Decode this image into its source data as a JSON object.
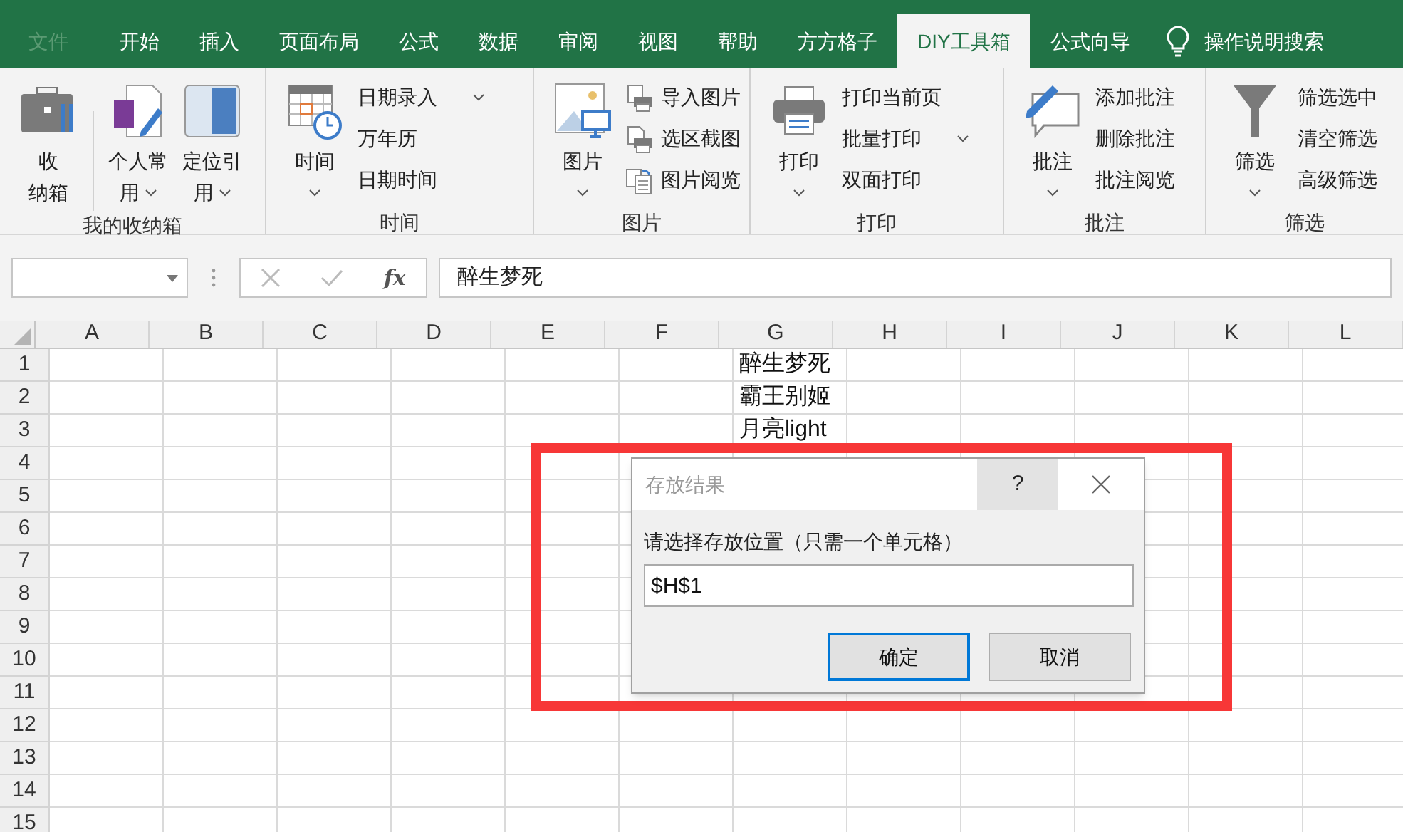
{
  "tabs": [
    {
      "label": "文件",
      "kind": "file",
      "selected": false
    },
    {
      "label": "开始",
      "kind": "tab",
      "selected": false
    },
    {
      "label": "插入",
      "kind": "tab",
      "selected": false
    },
    {
      "label": "页面布局",
      "kind": "tab",
      "selected": false
    },
    {
      "label": "公式",
      "kind": "tab",
      "selected": false
    },
    {
      "label": "数据",
      "kind": "tab",
      "selected": false
    },
    {
      "label": "审阅",
      "kind": "tab",
      "selected": false
    },
    {
      "label": "视图",
      "kind": "tab",
      "selected": false
    },
    {
      "label": "帮助",
      "kind": "tab",
      "selected": false
    },
    {
      "label": "方方格子",
      "kind": "tab",
      "selected": false
    },
    {
      "label": "DIY工具箱",
      "kind": "tab",
      "selected": true
    },
    {
      "label": "公式向导",
      "kind": "tab",
      "selected": false
    }
  ],
  "tell_me": {
    "label": "操作说明搜索"
  },
  "ribbon_groups": [
    {
      "label": "我的收纳箱",
      "large": [
        {
          "lines": [
            "收",
            "纳箱"
          ],
          "dropdown": false
        },
        {
          "lines": [
            "个人常",
            "用"
          ],
          "dropdown": true
        },
        {
          "lines": [
            "定位引",
            "用"
          ],
          "dropdown": true
        }
      ]
    },
    {
      "label": "时间",
      "large": [
        {
          "lines": [
            "时间"
          ],
          "dropdown": true
        }
      ],
      "small": [
        {
          "label": "日期录入",
          "dropdown": true
        },
        {
          "label": "万年历",
          "dropdown": false
        },
        {
          "label": "日期时间",
          "dropdown": false
        }
      ]
    },
    {
      "label": "图片",
      "large": [
        {
          "lines": [
            "图片"
          ],
          "dropdown": true
        }
      ],
      "small": [
        {
          "label": "导入图片",
          "dropdown": false
        },
        {
          "label": "选区截图",
          "dropdown": false
        },
        {
          "label": "图片阅览",
          "dropdown": false
        }
      ]
    },
    {
      "label": "打印",
      "large": [
        {
          "lines": [
            "打印"
          ],
          "dropdown": true
        }
      ],
      "small": [
        {
          "label": "打印当前页",
          "dropdown": false
        },
        {
          "label": "批量打印",
          "dropdown": true
        },
        {
          "label": "双面打印",
          "dropdown": false
        }
      ]
    },
    {
      "label": "批注",
      "large": [
        {
          "lines": [
            "批注"
          ],
          "dropdown": true
        }
      ],
      "small": [
        {
          "label": "添加批注",
          "dropdown": false
        },
        {
          "label": "删除批注",
          "dropdown": false
        },
        {
          "label": "批注阅览",
          "dropdown": false
        }
      ]
    },
    {
      "label": "筛选",
      "large": [
        {
          "lines": [
            "筛选"
          ],
          "dropdown": true
        }
      ],
      "small": [
        {
          "label": "筛选选中",
          "dropdown": false
        },
        {
          "label": "清空筛选",
          "dropdown": false
        },
        {
          "label": "高级筛选",
          "dropdown": false
        }
      ]
    }
  ],
  "formula_bar": {
    "function_label": "fx",
    "value": "醉生梦死"
  },
  "sheet": {
    "columns": [
      {
        "label": "A"
      },
      {
        "label": "B"
      },
      {
        "label": "C"
      },
      {
        "label": "D"
      },
      {
        "label": "E"
      },
      {
        "label": "F"
      },
      {
        "label": "G",
        "cells": [
          "醉生梦死",
          "霸王别姬",
          "月亮light"
        ]
      },
      {
        "label": "H"
      },
      {
        "label": "I"
      },
      {
        "label": "J"
      },
      {
        "label": "K"
      },
      {
        "label": "L"
      }
    ],
    "rows": [
      "1",
      "2",
      "3",
      "4",
      "5",
      "6",
      "7",
      "8",
      "9",
      "10",
      "11",
      "12",
      "13",
      "14",
      "15"
    ]
  },
  "dialog": {
    "title": "存放结果",
    "help": "?",
    "prompt": "请选择存放位置（只需一个单元格）",
    "value": "$H$1",
    "buttons": [
      {
        "label": "确定",
        "default": true
      },
      {
        "label": "取消",
        "default": false
      }
    ]
  }
}
